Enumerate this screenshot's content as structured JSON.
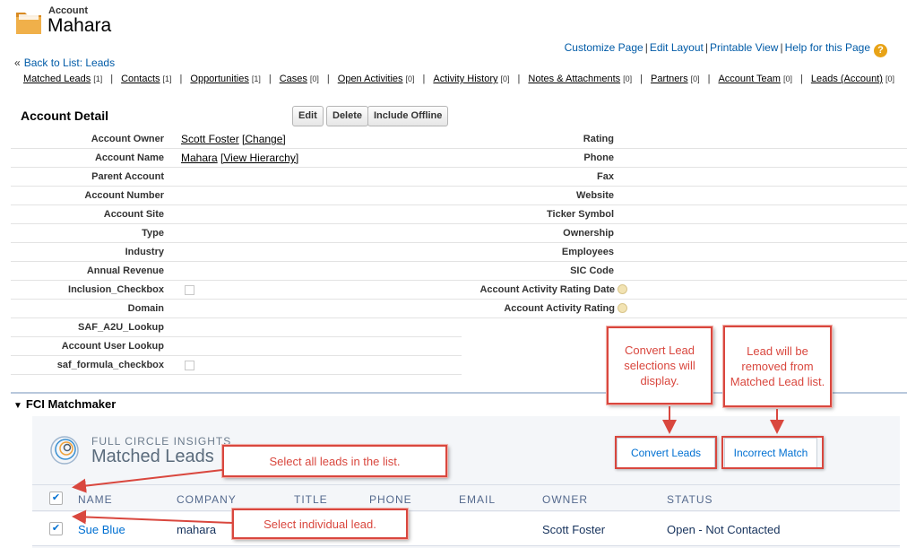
{
  "header": {
    "object_type": "Account",
    "account_name": "Mahara",
    "icon": "folder-icon"
  },
  "top_links": {
    "customize": "Customize Page",
    "edit_layout": "Edit Layout",
    "printable": "Printable View",
    "help": "Help for this Page",
    "help_icon": "?",
    "separator": "|"
  },
  "back_link": {
    "prefix": "«",
    "label": "Back to List: Leads"
  },
  "related_lists": [
    {
      "label": "Matched Leads",
      "count": "[1]"
    },
    {
      "label": "Contacts",
      "count": "[1]"
    },
    {
      "label": "Opportunities",
      "count": "[1]"
    },
    {
      "label": "Cases",
      "count": "[0]"
    },
    {
      "label": "Open Activities",
      "count": "[0]"
    },
    {
      "label": "Activity History",
      "count": "[0]"
    },
    {
      "label": "Notes & Attachments",
      "count": "[0]"
    },
    {
      "label": "Partners",
      "count": "[0]"
    },
    {
      "label": "Account Team",
      "count": "[0]"
    },
    {
      "label": "Leads (Account)",
      "count": "[0]"
    }
  ],
  "detail": {
    "title": "Account Detail",
    "buttons": {
      "edit": "Edit",
      "delete": "Delete",
      "include_offline": "Include Offline"
    },
    "left_fields": [
      {
        "label": "Account Owner",
        "value": "Scott Foster",
        "link": "[Change]"
      },
      {
        "label": "Account Name",
        "value": "Mahara",
        "link": "[View Hierarchy]"
      },
      {
        "label": "Parent Account",
        "value": ""
      },
      {
        "label": "Account Number",
        "value": ""
      },
      {
        "label": "Account Site",
        "value": ""
      },
      {
        "label": "Type",
        "value": ""
      },
      {
        "label": "Industry",
        "value": ""
      },
      {
        "label": "Annual Revenue",
        "value": ""
      },
      {
        "label": "Inclusion_Checkbox",
        "value": ""
      },
      {
        "label": "Domain",
        "value": ""
      },
      {
        "label": "SAF_A2U_Lookup",
        "value": ""
      },
      {
        "label": "Account User Lookup",
        "value": ""
      },
      {
        "label": "saf_formula_checkbox",
        "value": ""
      }
    ],
    "right_fields": [
      {
        "label": "Rating"
      },
      {
        "label": "Phone"
      },
      {
        "label": "Fax"
      },
      {
        "label": "Website"
      },
      {
        "label": "Ticker Symbol"
      },
      {
        "label": "Ownership"
      },
      {
        "label": "Employees"
      },
      {
        "label": "SIC Code"
      },
      {
        "label": "Account Activity Rating Date"
      },
      {
        "label": "Account Activity Rating"
      }
    ]
  },
  "matchmaker": {
    "section_title": "FCI Matchmaker",
    "collapse_glyph": "▼",
    "brand": "FULL CIRCLE INSIGHTS",
    "title": "Matched Leads",
    "convert_button": "Convert Leads",
    "incorrect_button": "Incorrect Match",
    "columns": [
      "NAME",
      "COMPANY",
      "TITLE",
      "PHONE",
      "EMAIL",
      "OWNER",
      "STATUS"
    ],
    "rows": [
      {
        "name": "Sue Blue",
        "company": "mahara",
        "title": "",
        "phone": "",
        "email": "",
        "owner": "Scott Foster",
        "status": "Open - Not Contacted",
        "checked": true
      }
    ],
    "select_all_checked": true,
    "check_glyph": "✔"
  },
  "annotations": {
    "convert_note": "Convert Lead selections will display.",
    "incorrect_note": "Lead will be removed from Matched Lead list.",
    "select_all_note": "Select all leads in the list.",
    "select_one_note": "Select individual lead.",
    "color": "#d9473e"
  },
  "colors": {
    "link": "#015ba7",
    "lightning_blue": "#0070d2",
    "callout_red": "#d9473e",
    "folder_orange": "#e8a540"
  }
}
